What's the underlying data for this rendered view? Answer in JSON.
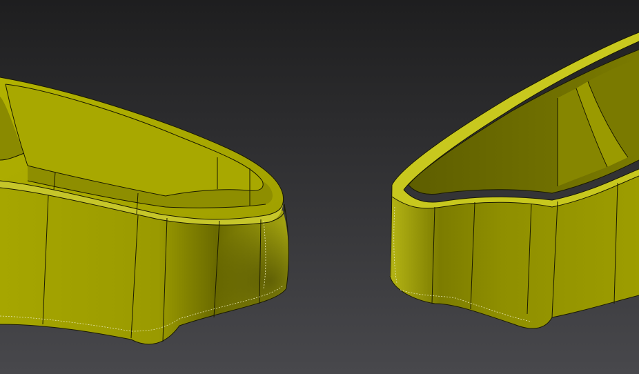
{
  "scene": {
    "description_visible_text": "",
    "background_gradient": [
      "#1e1e1f",
      "#47474b"
    ],
    "part_color": "#9e9e00",
    "part_highlight": "#c8c81a",
    "part_shadow": "#4a4a00",
    "edge_color": "#1a1a00"
  },
  "objects": [
    {
      "name": "left-bracket-model"
    },
    {
      "name": "right-bracket-model"
    }
  ]
}
